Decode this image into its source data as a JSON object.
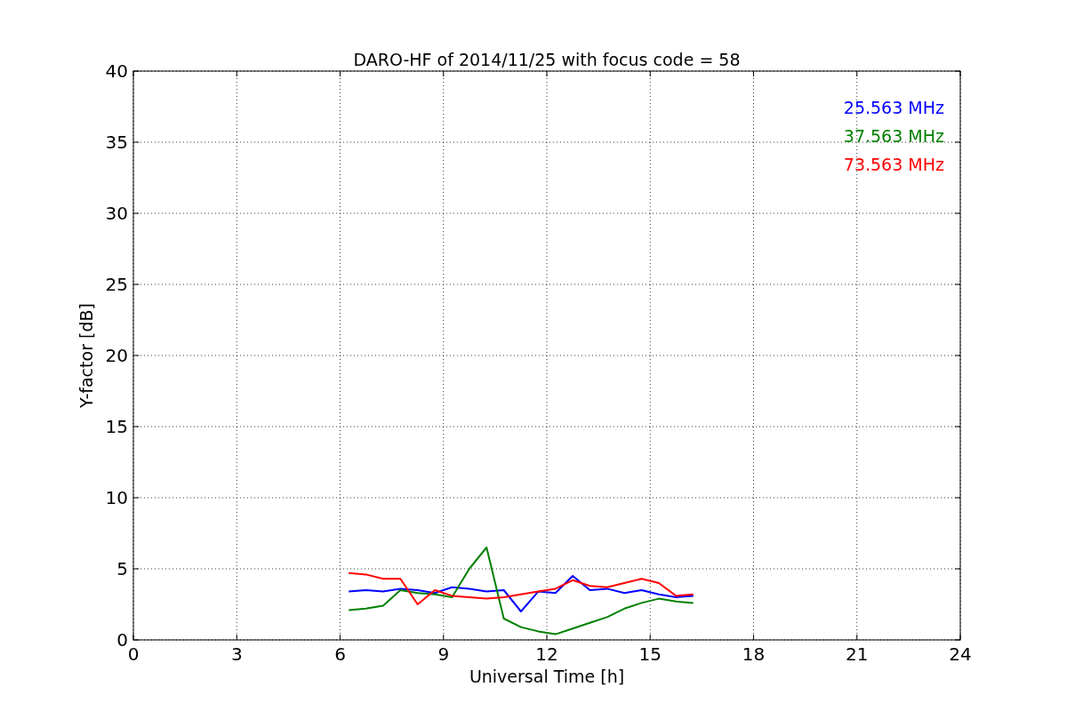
{
  "chart_data": {
    "type": "line",
    "title": "DARO-HF of 2014/11/25 with focus code = 58",
    "xlabel": "Universal Time [h]",
    "ylabel": "Y-factor [dB]",
    "x": [
      6.25,
      6.75,
      7.25,
      7.75,
      8.25,
      8.75,
      9.25,
      9.75,
      10.25,
      10.75,
      11.25,
      11.75,
      12.25,
      12.75,
      13.25,
      13.75,
      14.25,
      14.75,
      15.25,
      15.75,
      16.25
    ],
    "series": [
      {
        "name": "25.563 MHz",
        "color": "#0000ff",
        "values": [
          3.4,
          3.5,
          3.4,
          3.6,
          3.5,
          3.3,
          3.7,
          3.6,
          3.4,
          3.5,
          2.0,
          3.4,
          3.3,
          4.5,
          3.5,
          3.6,
          3.3,
          3.5,
          3.2,
          3.0,
          3.1
        ]
      },
      {
        "name": "37.563 MHz",
        "color": "#008000",
        "values": [
          2.1,
          2.2,
          2.4,
          3.5,
          3.3,
          3.2,
          3.0,
          5.0,
          6.5,
          1.5,
          0.9,
          0.6,
          0.4,
          0.8,
          1.2,
          1.6,
          2.2,
          2.6,
          2.9,
          2.7,
          2.6
        ]
      },
      {
        "name": "73.563 MHz",
        "color": "#ff0000",
        "values": [
          4.7,
          4.6,
          4.3,
          4.3,
          2.5,
          3.5,
          3.1,
          3.0,
          2.9,
          3.0,
          3.2,
          3.4,
          3.6,
          4.2,
          3.8,
          3.7,
          4.0,
          4.3,
          4.0,
          3.1,
          3.2
        ]
      }
    ],
    "grid": true,
    "xlim": [
      0,
      24
    ],
    "ylim": [
      0,
      40
    ],
    "xticks": [
      0,
      3,
      6,
      9,
      12,
      15,
      18,
      21,
      24
    ],
    "yticks": [
      0,
      5,
      10,
      15,
      20,
      25,
      30,
      35,
      40
    ]
  }
}
